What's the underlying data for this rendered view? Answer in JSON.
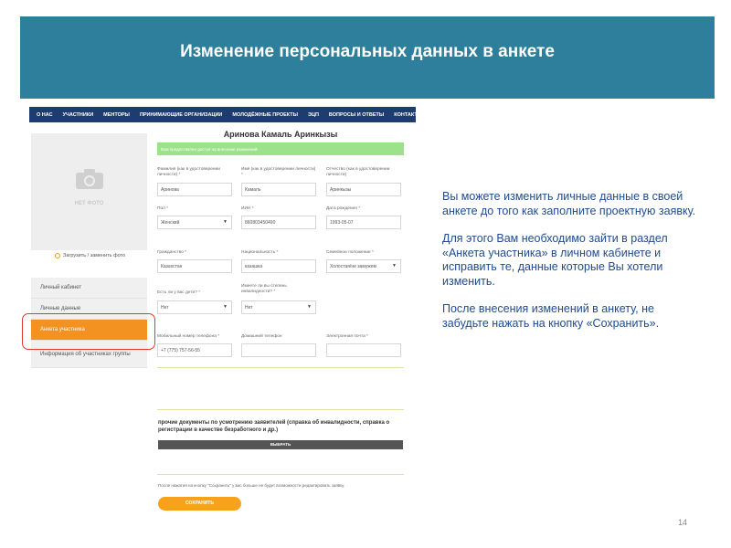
{
  "title": "Изменение персональных данных в анкете",
  "nav": [
    "О НАС",
    "УЧАСТНИКИ",
    "МЕНТОРЫ",
    "ПРИНИМАЮЩИЕ ОРГАНИЗАЦИИ",
    "МОЛОДЁЖНЫЕ ПРОЕКТЫ",
    "ЭЦП",
    "ВОПРОСЫ И ОТВЕТЫ",
    "КОНТАКТЫ"
  ],
  "profile": {
    "no_photo": "НЕТ ФОТО",
    "upload_label": "Загрузить / заменить фото"
  },
  "menu": [
    "Личный кабинет",
    "Личные данные",
    "Анкета участника",
    "Информация об участниках группы"
  ],
  "form": {
    "name": "Аринова Камаль Аринкызы",
    "notice": "Вам предоставлен доступ на внесение изменений",
    "fields": [
      {
        "label": "Фамилия (как в удостоверении личности)",
        "value": "Аринова"
      },
      {
        "label": "Имя (как в удостоверении личности)",
        "value": "Камаль"
      },
      {
        "label": "Отчество (как в удостоверении личности)",
        "value": "Аринкызы"
      },
      {
        "label": "Пол",
        "value": "Женский"
      },
      {
        "label": "ИИН",
        "value": "860803450490"
      },
      {
        "label": "Дата рождения",
        "value": "1993-05-07"
      },
      {
        "label": "Гражданство",
        "value": "Казахстан"
      },
      {
        "label": "Национальность",
        "value": "казашка"
      },
      {
        "label": "Семейное положение",
        "value": "Холостая/не замужем"
      },
      {
        "label": "Есть ли у вас дети?",
        "value": "Нет"
      },
      {
        "label": "Имеете ли вы степень инвалидности?",
        "value": "Нет"
      },
      {
        "label": "Мобильный номер телефона",
        "value": "+7 (775) 757-56-55"
      },
      {
        "label": "Домашний телефон",
        "value": ""
      },
      {
        "label": "Электронная почта",
        "value": ""
      }
    ],
    "docs_label": "прочие документы по усмотрению заявителей (справка об инвалидности, справка о регистрации в качестве безработного и др.)",
    "choose_button": "ВЫБРАТЬ",
    "save_note": "После нажатия на кнопку \"Сохранить\" у вас больше не будет возможности редактировать заявку.",
    "save_button": "СОХРАНИТЬ"
  },
  "instructions": [
    "Вы можете изменить личные данные в своей анкете до того как заполните проектную заявку.",
    "Для этого Вам необходимо зайти в раздел «Анкета участника» в личном кабинете и исправить те, данные которые Вы хотели изменить.",
    "После внесения изменений в анкету, не забудьте нажать на кнопку «Сохранить»."
  ],
  "page_number": "14"
}
